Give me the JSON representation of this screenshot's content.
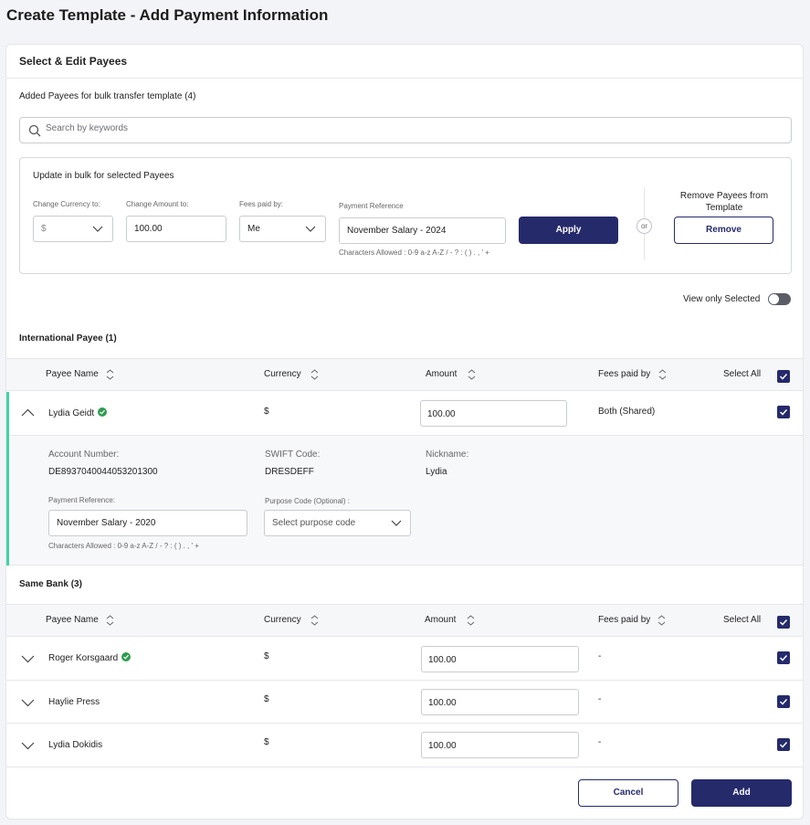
{
  "page": {
    "title": "Create Template - Add Payment Information"
  },
  "card": {
    "title": "Select & Edit Payees"
  },
  "payees": {
    "added_label": "Added Payees for bulk transfer template (4)",
    "search_placeholder": "Search by keywords"
  },
  "bulk": {
    "title": "Update in bulk for selected Payees",
    "currency_label": "Change Currency to:",
    "currency_value": "$",
    "amount_label": "Change Amount to:",
    "amount_value": "100.00",
    "fees_label": "Fees paid by:",
    "fees_value": "Me",
    "reference_label": "Payment Reference",
    "reference_value": "November Salary - 2024",
    "chars_allowed": "Characters Allowed : 0-9 a-z A-Z / - ? : ( ) . , ' +",
    "apply_label": "Apply",
    "or_label": "or",
    "remove_title": "Remove Payees from Template",
    "remove_label": "Remove"
  },
  "view_only_selected": {
    "label": "View only Selected",
    "on": false
  },
  "table_headers": {
    "payee_name": "Payee Name",
    "currency": "Currency",
    "amount": "Amount",
    "fees_paid_by": "Fees paid by",
    "select_all": "Select All"
  },
  "international": {
    "title": "International Payee (1)",
    "rows": [
      {
        "name": "Lydia Geidt",
        "verified": true,
        "currency": "$",
        "amount": "100.00",
        "fees": "Both (Shared)",
        "checked": true,
        "expanded": true,
        "details": {
          "account_label": "Account Number:",
          "account_value": "DE8937040044053201300",
          "swift_label": "SWIFT Code:",
          "swift_value": "DRESDEFF",
          "nickname_label": "Nickname:",
          "nickname_value": "Lydia",
          "reference_label": "Payment Reference:",
          "reference_value": "November Salary - 2020",
          "purpose_label": "Purpose Code (Optional) :",
          "purpose_placeholder": "Select purpose code",
          "chars_allowed": "Characters Allowed : 0-9 a-z A-Z / - ? : ( ) . , ' +"
        }
      }
    ]
  },
  "same_bank": {
    "title": "Same Bank (3)",
    "rows": [
      {
        "name": "Roger Korsgaard",
        "verified": true,
        "currency": "$",
        "amount": "100.00",
        "fees": "-",
        "checked": true
      },
      {
        "name": "Haylie Press",
        "verified": false,
        "currency": "$",
        "amount": "100.00",
        "fees": "-",
        "checked": true
      },
      {
        "name": "Lydia Dokidis",
        "verified": false,
        "currency": "$",
        "amount": "100.00",
        "fees": "-",
        "checked": true
      }
    ]
  },
  "footer": {
    "cancel_label": "Cancel",
    "add_label": "Add"
  },
  "colors": {
    "primary": "#252a6b",
    "verified": "#2e9c4f",
    "accent": "#3fd4a5"
  },
  "icons": [
    "search-icon",
    "chevron-down-icon",
    "sort-icon",
    "check-icon",
    "verified-icon",
    "chevron-up-icon"
  ]
}
